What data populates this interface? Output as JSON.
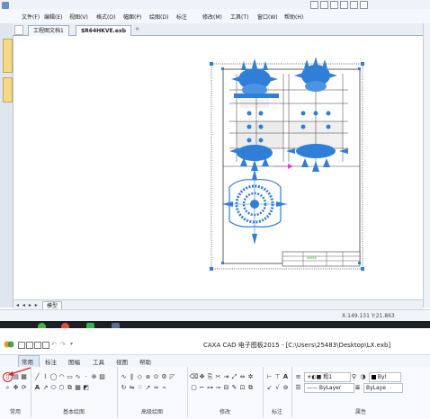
{
  "app": {
    "tabs": [
      {
        "label": "工程图文档1"
      },
      {
        "label": "$R64HKVE.exb"
      }
    ],
    "menu": [
      "文件(F)",
      "编辑(E)",
      "视图(V)",
      "格式(O)",
      "幅面(P)",
      "绘图(D)",
      "标注",
      "修改(M)",
      "工具(T)",
      "窗口(W)",
      "帮助(H)"
    ],
    "layout_tab": "模型",
    "status_text": "X:149.131 Y:21.863"
  },
  "drawing": {
    "title_block_text": "XXXXX"
  },
  "bottom_window": {
    "title": "CAXA CAD 电子图板2015 - [C:\\Users\\25483\\Desktop\\LX.exb]",
    "ribbon_tabs": [
      "常用",
      "标注",
      "图幅",
      "工具",
      "视图",
      "帮助"
    ],
    "groups": [
      {
        "label": "常用"
      },
      {
        "label": "基本绘图"
      },
      {
        "label": "高级绘图"
      },
      {
        "label": "修改"
      },
      {
        "label": "标注"
      },
      {
        "label": "属性"
      }
    ],
    "layer_value": "粗1",
    "linetype_value": "ByLayer",
    "color_value": "ByLayer",
    "byl_value": "Byl",
    "byla_value": "ByLaye"
  },
  "colors": {
    "cad_blue": "#2f7fd8",
    "annotation_red": "#d42020",
    "frame_gray": "#3a3a3a"
  }
}
